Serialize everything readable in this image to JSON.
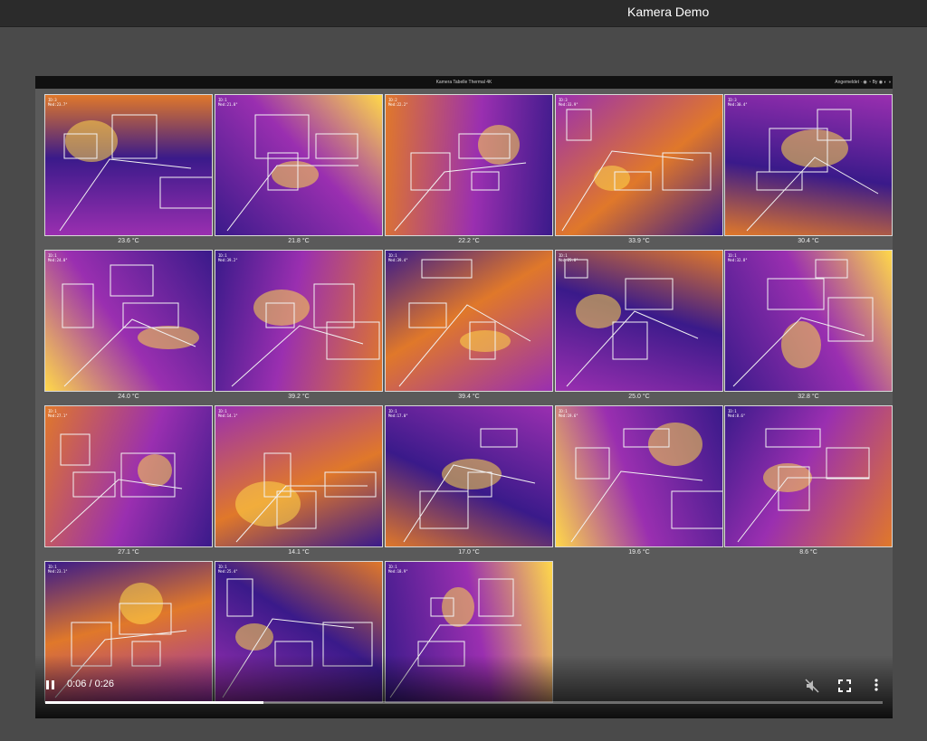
{
  "window": {
    "title": "Kamera Demo"
  },
  "video": {
    "header_title": "Kamera Tabelle Thermal 4K",
    "header_right": "Angemeldet · ◉ ◔ By ◉ ◐ ◑",
    "tiles": [
      {
        "temp": "23.6 °C",
        "tag": "ID:3\nMed:23.7°"
      },
      {
        "temp": "21.8 °C",
        "tag": "ID:1\nMed:21.8°"
      },
      {
        "temp": "22.2 °C",
        "tag": "ID:2\nMed:22.2°"
      },
      {
        "temp": "33.9 °C",
        "tag": "ID:3\nMed:33.9°"
      },
      {
        "temp": "30.4 °C",
        "tag": "ID:3\nMed:30.4°"
      },
      {
        "temp": "24.0 °C",
        "tag": "ID:1\nMed:24.0°"
      },
      {
        "temp": "39.2 °C",
        "tag": "ID:1\nMed:39.2°"
      },
      {
        "temp": "39.4 °C",
        "tag": "ID:1\nMed:39.4°"
      },
      {
        "temp": "25.0 °C",
        "tag": "ID:1\nMed:25.0°"
      },
      {
        "temp": "32.8 °C",
        "tag": "ID:1\nMed:32.8°"
      },
      {
        "temp": "27.1 °C",
        "tag": "ID:1\nMed:27.1°"
      },
      {
        "temp": "14.1 °C",
        "tag": "ID:1\nMed:14.1°"
      },
      {
        "temp": "17.0 °C",
        "tag": "ID:1\nMed:17.0°"
      },
      {
        "temp": "19.6 °C",
        "tag": "ID:1\nMed:19.6°"
      },
      {
        "temp": "8.6 °C",
        "tag": "ID:1\nMed:8.6°"
      },
      {
        "temp": "",
        "tag": "ID:1\nMed:23.1°"
      },
      {
        "temp": "",
        "tag": "ID:1\nMed:25.4°"
      },
      {
        "temp": "",
        "tag": "ID:1\nMed:18.9°"
      }
    ]
  },
  "controls": {
    "time": "0:06 / 0:26",
    "progress_fraction": 0.26,
    "play_icon": "pause-icon",
    "mute_icon": "volume-muted-icon",
    "fullscreen_icon": "fullscreen-icon",
    "more_icon": "more-vertical-icon"
  },
  "colors": {
    "thermal_cold": "#3a1a8a",
    "thermal_mid": "#9a2fb0",
    "thermal_warm": "#e0782a",
    "thermal_hot": "#ffd84a"
  }
}
